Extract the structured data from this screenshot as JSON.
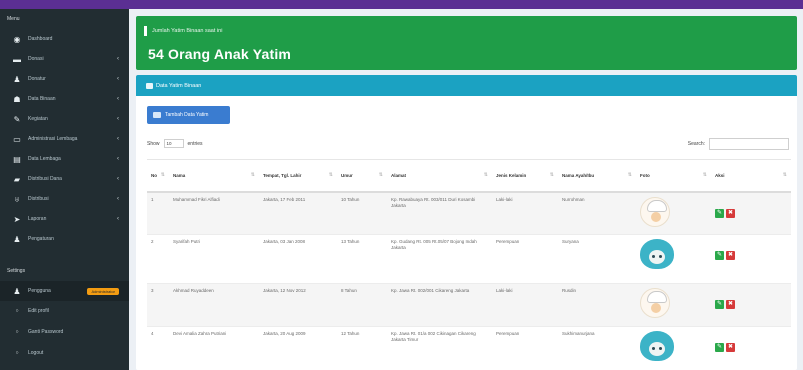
{
  "sidebar": {
    "header": "Menu",
    "items": [
      {
        "icon": "dashboard-icon",
        "glyph": "◉",
        "label": "Dashboard",
        "chevron": false
      },
      {
        "icon": "card-icon",
        "glyph": "▬",
        "label": "Donasi",
        "chevron": true
      },
      {
        "icon": "user-icon",
        "glyph": "♟",
        "label": "Donatur",
        "chevron": true
      },
      {
        "icon": "group-icon",
        "glyph": "☗",
        "label": "Data Binaan",
        "chevron": true
      },
      {
        "icon": "brush-icon",
        "glyph": "✎",
        "label": "Kegiatan",
        "chevron": true
      },
      {
        "icon": "monitor-icon",
        "glyph": "▭",
        "label": "Administrasi Lembaga",
        "chevron": true
      },
      {
        "icon": "book-icon",
        "glyph": "▤",
        "label": "Data Lembaga",
        "chevron": true
      },
      {
        "icon": "car-icon",
        "glyph": "▰",
        "label": "Distribusi Dana",
        "chevron": true
      },
      {
        "icon": "cup-icon",
        "glyph": "♅",
        "label": "Distribusi",
        "chevron": true
      },
      {
        "icon": "send-icon",
        "glyph": "➤",
        "label": "Laporan",
        "chevron": true
      },
      {
        "icon": "person-icon",
        "glyph": "♟",
        "label": "Pengaturan",
        "chevron": false
      }
    ],
    "section": "Settings",
    "account": {
      "icon": "user-icon",
      "glyph": "♟",
      "label": "Pengguna",
      "badge": "Administrator"
    },
    "sub_items": [
      {
        "icon": "circle-icon",
        "glyph": "○",
        "label": "Edit profil"
      },
      {
        "icon": "circle-icon",
        "glyph": "○",
        "label": "Ganti Password"
      },
      {
        "icon": "circle-icon",
        "glyph": "○",
        "label": "Logout"
      }
    ]
  },
  "callout": {
    "small": "Jumlah Yatim Binaan saat ini",
    "big": "54 Orang Anak Yatim"
  },
  "panel": {
    "title": "Data Yatim Binaan",
    "add_button": "Tambah Data Yatim",
    "show_label": "Show",
    "show_value": "10",
    "entries_label": "entries",
    "search_label": "Search:"
  },
  "table": {
    "headers": [
      "No",
      "Nama",
      "Tempat, Tgl. Lahir",
      "Umur",
      "Alamat",
      "Jenis Kelamin",
      "Nama Ayah/Ibu",
      "Foto",
      "Aksi"
    ],
    "rows": [
      {
        "no": "1",
        "nama": "Muhammad Fikri Alfiadi",
        "ttl": "Jakarta, 17 Feb 2011",
        "umur": "10 Tahun",
        "alamat": "Kp. Rawabuaya Rt. 003/011 Duri Kosambi Jakarta",
        "jk": "Laki-laki",
        "ortu": "Nurrohman",
        "foto": "boy"
      },
      {
        "no": "2",
        "nama": "Syarifah Putri",
        "ttl": "Jakarta, 03 Jan 2008",
        "umur": "13 Tahun",
        "alamat": "Kp. Gudang Rt. 005 Rt.05/07 Bojong Indah Jakarta",
        "jk": "Perempuan",
        "ortu": "Suryana",
        "foto": "girl"
      },
      {
        "no": "3",
        "nama": "Akhmad Ruyaddeen",
        "ttl": "Jakarta, 12 Nov 2012",
        "umur": "8 Tahun",
        "alamat": "Kp. Jawa Rt. 002/001 Cikareng Jakarta",
        "jk": "Laki-laki",
        "ortu": "Rusdin",
        "foto": "boy"
      },
      {
        "no": "4",
        "nama": "Devi Amalia Zahra Putriani",
        "ttl": "Jakarta, 20 Aug 2009",
        "umur": "12 Tahun",
        "alamat": "Kp. Jawa Rt. 01/a 002 Cikinagan Cikareng Jakarta Timur",
        "jk": "Perempuan",
        "ortu": "Sukhimanurjana",
        "foto": "girl"
      }
    ]
  }
}
